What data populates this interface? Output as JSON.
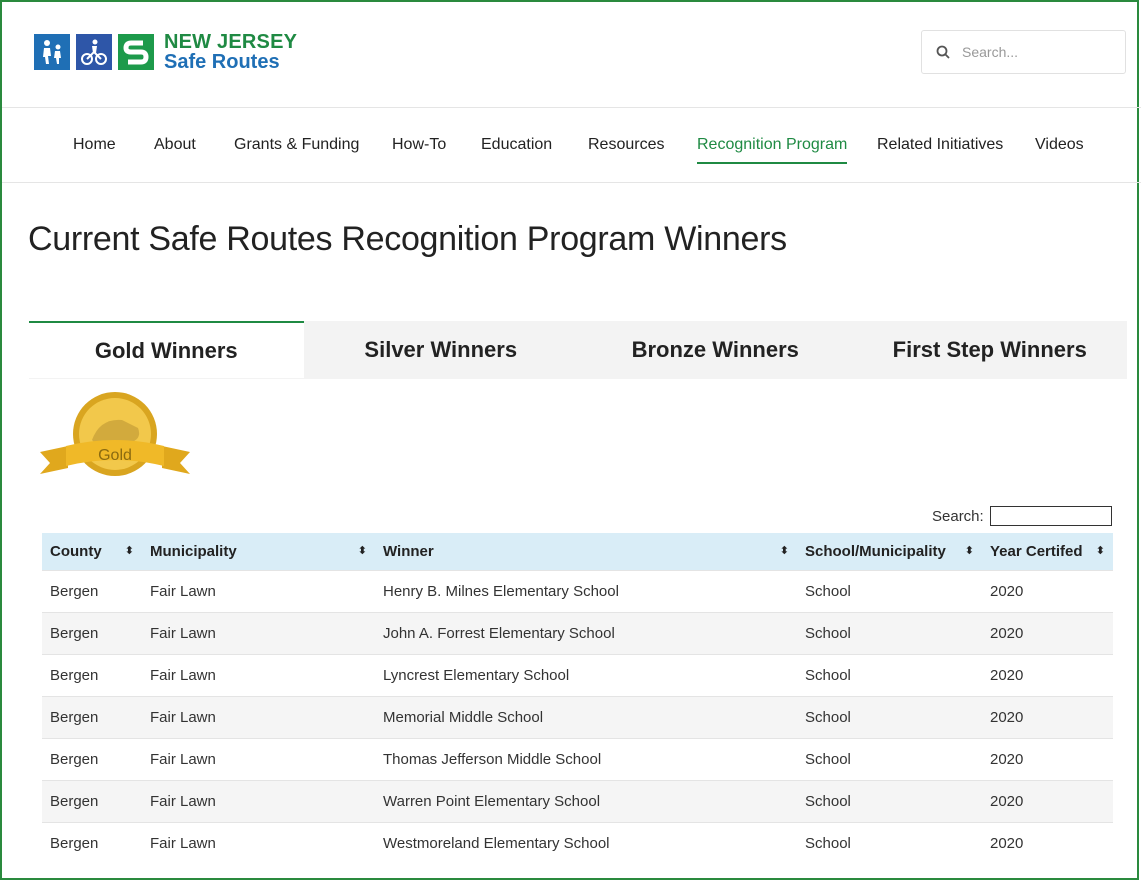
{
  "brand": {
    "line1": "NEW JERSEY",
    "line2": "Safe Routes"
  },
  "search": {
    "placeholder": "Search..."
  },
  "nav": [
    {
      "label": "Home"
    },
    {
      "label": "About"
    },
    {
      "label": "Grants & Funding"
    },
    {
      "label": "How-To"
    },
    {
      "label": "Education"
    },
    {
      "label": "Resources"
    },
    {
      "label": "Recognition Program",
      "active": true
    },
    {
      "label": "Related Initiatives"
    },
    {
      "label": "Videos"
    }
  ],
  "page_title": "Current Safe Routes Recognition Program Winners",
  "tabs": [
    {
      "label": "Gold Winners",
      "active": true
    },
    {
      "label": "Silver Winners"
    },
    {
      "label": "Bronze Winners"
    },
    {
      "label": "First Step Winners"
    }
  ],
  "medal": {
    "label": "Gold"
  },
  "table_search": {
    "label": "Search:"
  },
  "table": {
    "columns": [
      "County",
      "Municipality",
      "Winner",
      "School/Municipality",
      "Year Certifed"
    ],
    "rows": [
      [
        "Bergen",
        "Fair Lawn",
        "Henry B. Milnes Elementary School",
        "School",
        "2020"
      ],
      [
        "Bergen",
        "Fair Lawn",
        "John A. Forrest Elementary School",
        "School",
        "2020"
      ],
      [
        "Bergen",
        "Fair Lawn",
        "Lyncrest Elementary School",
        "School",
        "2020"
      ],
      [
        "Bergen",
        "Fair Lawn",
        "Memorial Middle School",
        "School",
        "2020"
      ],
      [
        "Bergen",
        "Fair Lawn",
        "Thomas Jefferson Middle School",
        "School",
        "2020"
      ],
      [
        "Bergen",
        "Fair Lawn",
        "Warren Point Elementary School",
        "School",
        "2020"
      ],
      [
        "Bergen",
        "Fair Lawn",
        "Westmoreland Elementary School",
        "School",
        "2020"
      ]
    ]
  },
  "colors": {
    "accent": "#1f8a43",
    "brand_blue": "#1f6fb5",
    "header_row": "#d9edf7"
  }
}
